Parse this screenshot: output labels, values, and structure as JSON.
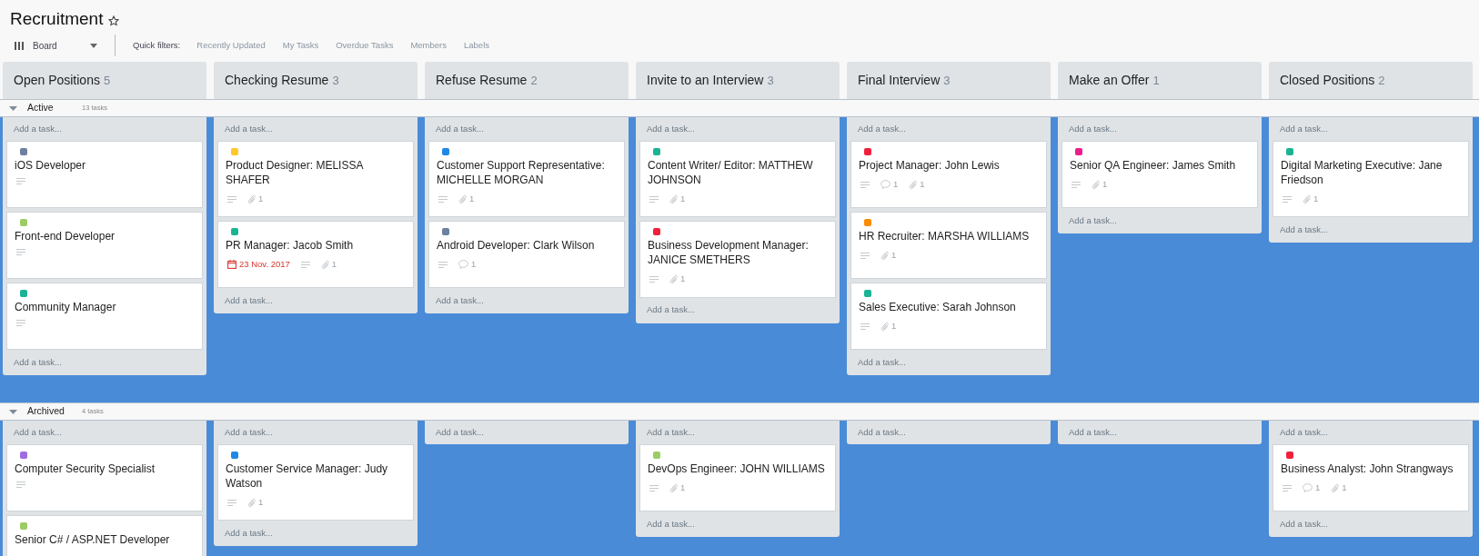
{
  "board": {
    "title": "Recruitment",
    "starred": false
  },
  "toolbar": {
    "view": "Board",
    "filters_label": "Quick filters:",
    "filters": [
      "Recently Updated",
      "My Tasks",
      "Overdue Tasks",
      "Members",
      "Labels"
    ]
  },
  "columns": [
    {
      "title": "Open Positions",
      "count": "5"
    },
    {
      "title": "Checking Resume",
      "count": "3"
    },
    {
      "title": "Refuse Resume",
      "count": "2"
    },
    {
      "title": "Invite to an Interview",
      "count": "3"
    },
    {
      "title": "Final Interview",
      "count": "3"
    },
    {
      "title": "Make an Offer",
      "count": "1"
    },
    {
      "title": "Closed Positions",
      "count": "2"
    }
  ],
  "lanes": [
    {
      "title": "Active",
      "count": "13 tasks",
      "expanded": true,
      "cells": [
        {
          "add_top": "Add a task...",
          "add_bottom": "Add a task...",
          "cards": [
            {
              "color": "#6e7fa0",
              "title": "iOS Developer",
              "badges": [
                {
                  "kind": "description"
                }
              ]
            },
            {
              "color": "#9ccc65",
              "title": "Front-end Developer",
              "badges": [
                {
                  "kind": "description"
                }
              ]
            },
            {
              "color": "#1ab394",
              "title": "Community Manager",
              "badges": [
                {
                  "kind": "description"
                }
              ]
            }
          ]
        },
        {
          "add_top": "Add a task...",
          "add_bottom": "Add a task...",
          "cards": [
            {
              "color": "#ffc828",
              "title": "Product Designer: MELISSA SHAFER",
              "badges": [
                {
                  "kind": "description"
                },
                {
                  "kind": "attachments",
                  "count": "1"
                }
              ]
            },
            {
              "color": "#1ab394",
              "title": "PR Manager: Jacob Smith",
              "badges": [
                {
                  "kind": "date",
                  "text": "23 Nov. 2017"
                },
                {
                  "kind": "description"
                },
                {
                  "kind": "attachments",
                  "count": "1"
                }
              ]
            }
          ]
        },
        {
          "add_top": "Add a task...",
          "add_bottom": "Add a task...",
          "cards": [
            {
              "color": "#1e88e5",
              "title": "Customer Support Representative: MICHELLE MORGAN",
              "badges": [
                {
                  "kind": "description"
                },
                {
                  "kind": "attachments",
                  "count": "1"
                }
              ]
            },
            {
              "color": "#6e7fa0",
              "title": "Android Developer: Clark Wilson",
              "badges": [
                {
                  "kind": "description"
                },
                {
                  "kind": "comments",
                  "count": "1"
                }
              ]
            }
          ]
        },
        {
          "add_top": "Add a task...",
          "add_bottom": "Add a task...",
          "cards": [
            {
              "color": "#1ab394",
              "title": "Content Writer/ Editor: MATTHEW JOHNSON",
              "badges": [
                {
                  "kind": "description"
                },
                {
                  "kind": "attachments",
                  "count": "1"
                }
              ]
            },
            {
              "color": "#f0203c",
              "title": "Business Development Manager: JANICE SMETHERS",
              "badges": [
                {
                  "kind": "description"
                },
                {
                  "kind": "attachments",
                  "count": "1"
                }
              ]
            }
          ]
        },
        {
          "add_top": "Add a task...",
          "add_bottom": "Add a task...",
          "cards": [
            {
              "color": "#f0203c",
              "title": "Project Manager: John Lewis",
              "badges": [
                {
                  "kind": "description"
                },
                {
                  "kind": "comments",
                  "count": "1"
                },
                {
                  "kind": "attachments",
                  "count": "1"
                }
              ]
            },
            {
              "color": "#fb8c00",
              "title": "HR Recruiter: MARSHA WILLIAMS",
              "badges": [
                {
                  "kind": "description"
                },
                {
                  "kind": "attachments",
                  "count": "1"
                }
              ]
            },
            {
              "color": "#1ab394",
              "title": "Sales Executive: Sarah Johnson",
              "badges": [
                {
                  "kind": "description"
                },
                {
                  "kind": "attachments",
                  "count": "1"
                }
              ]
            }
          ]
        },
        {
          "add_top": "Add a task...",
          "add_bottom": "Add a task...",
          "cards": [
            {
              "color": "#e91e8c",
              "title": "Senior QA Engineer: James Smith",
              "badges": [
                {
                  "kind": "description"
                },
                {
                  "kind": "attachments",
                  "count": "1"
                }
              ]
            }
          ]
        },
        {
          "add_top": "Add a task...",
          "add_bottom": "Add a task...",
          "cards": [
            {
              "color": "#1ab394",
              "title": "Digital Marketing Executive: Jane Friedson",
              "badges": [
                {
                  "kind": "description"
                },
                {
                  "kind": "attachments",
                  "count": "1"
                }
              ]
            }
          ]
        }
      ]
    },
    {
      "title": "Archived",
      "count": "4 tasks",
      "expanded": true,
      "cells": [
        {
          "add_top": "Add a task...",
          "cards": [
            {
              "color": "#9c6ee0",
              "title": "Computer Security Specialist",
              "badges": [
                {
                  "kind": "description"
                }
              ]
            },
            {
              "color": "#9ccc65",
              "title": "Senior C# / ASP.NET Developer"
            }
          ]
        },
        {
          "add_top": "Add a task...",
          "add_bottom": "Add a task...",
          "cards": [
            {
              "color": "#1e88e5",
              "title": "Customer Service Manager: Judy Watson",
              "badges": [
                {
                  "kind": "description"
                },
                {
                  "kind": "attachments",
                  "count": "1"
                }
              ]
            }
          ]
        },
        {
          "add_top": "Add a task..."
        },
        {
          "add_top": "Add a task...",
          "add_bottom": "Add a task...",
          "cards": [
            {
              "color": "#9ccc65",
              "title": "DevOps Engineer: JOHN WILLIAMS",
              "badges": [
                {
                  "kind": "description"
                },
                {
                  "kind": "attachments",
                  "count": "1"
                }
              ]
            }
          ]
        },
        {
          "add_top": "Add a task..."
        },
        {
          "add_top": "Add a task..."
        },
        {
          "add_top": "Add a task...",
          "add_bottom": "Add a task...",
          "cards": [
            {
              "color": "#f0203c",
              "title": "Business Analyst: John Strangways",
              "badges": [
                {
                  "kind": "description"
                },
                {
                  "kind": "comments",
                  "count": "1"
                },
                {
                  "kind": "attachments",
                  "count": "1"
                }
              ]
            }
          ]
        }
      ]
    }
  ]
}
